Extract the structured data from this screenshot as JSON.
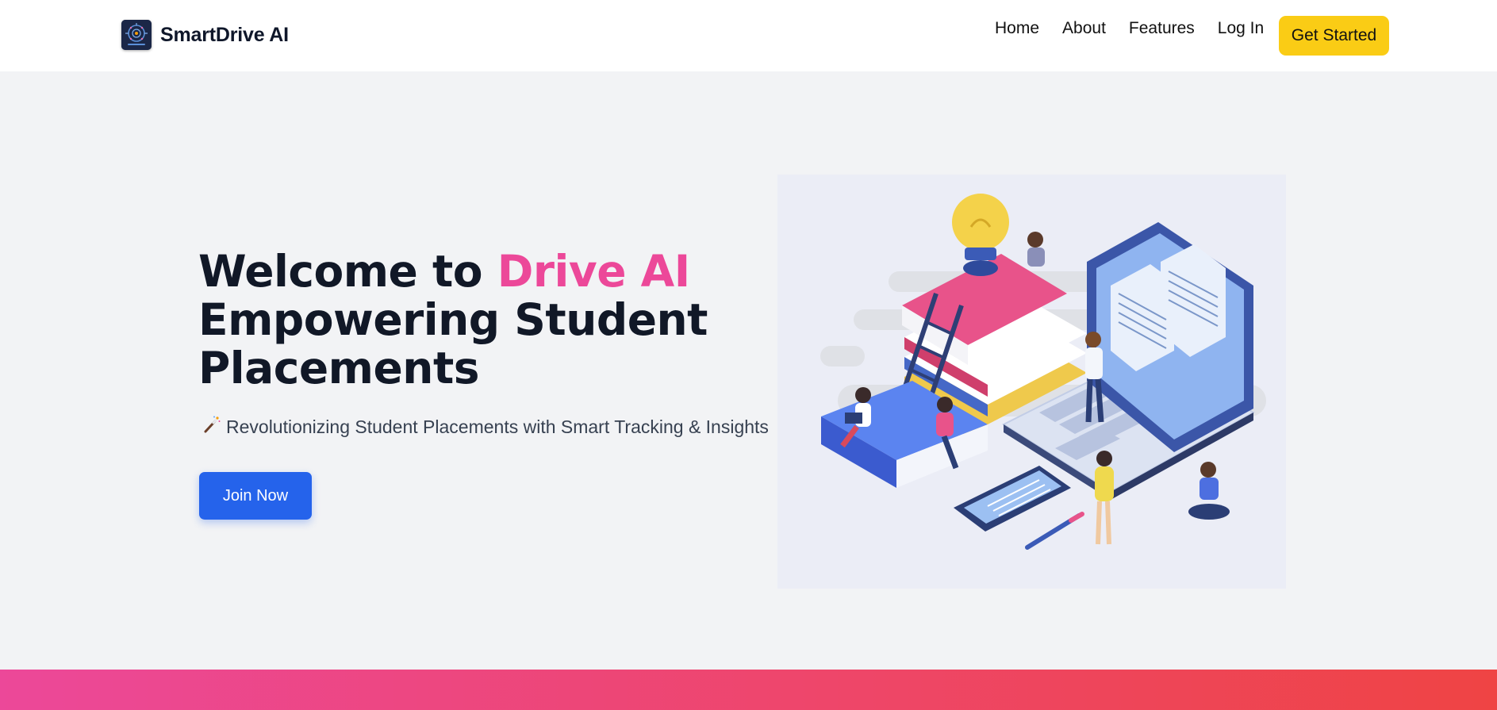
{
  "brand": {
    "name": "SmartDrive AI",
    "logo_icon": "brain-circuit-icon"
  },
  "nav": {
    "links": [
      "Home",
      "About",
      "Features",
      "Log In"
    ],
    "cta_label": "Get Started",
    "cta_color": "#facc15"
  },
  "hero": {
    "title_part1": "Welcome to ",
    "title_accent": "Drive AI",
    "title_line2": "Empowering Student",
    "title_line3": "Placements",
    "accent_color": "#ec4899",
    "subtitle_icon": "magic-wand-icon",
    "subtitle": "Revolutionizing Student Placements with Smart Tracking & Insights",
    "button_label": "Join Now",
    "button_color": "#2563eb"
  },
  "illustration": {
    "icon": "students-studying-illustration"
  },
  "colors": {
    "page_bg": "#f2f3f5",
    "footer_gradient_start": "#ec4899",
    "footer_gradient_end": "#ef4444"
  }
}
